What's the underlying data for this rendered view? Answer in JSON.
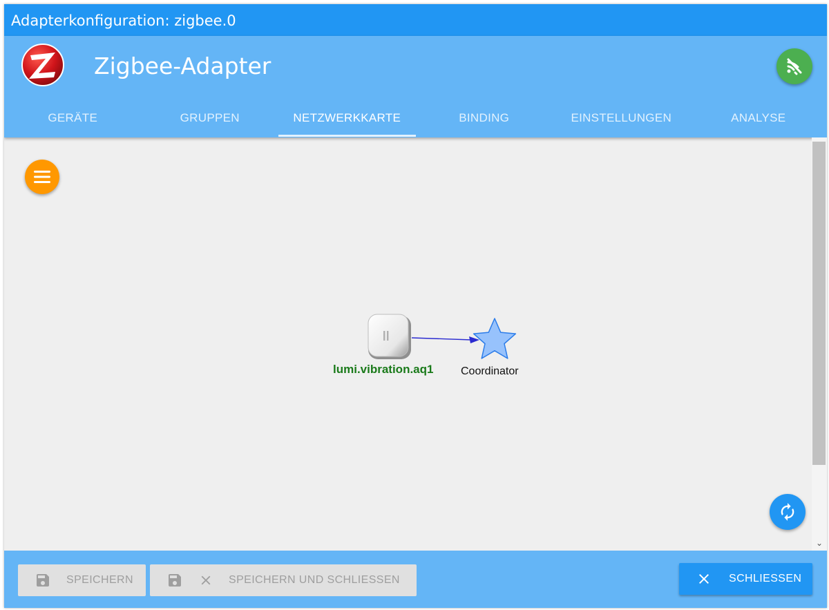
{
  "window": {
    "title": "Adapterkonfiguration: zigbee.0"
  },
  "appbar": {
    "title": "Zigbee-Adapter",
    "logo_icon": "zigbee-logo-icon",
    "status_icon": "wifi-signal-icon",
    "status_color": "#4caf50"
  },
  "tabs": [
    {
      "label": "GERÄTE",
      "active": false
    },
    {
      "label": "GRUPPEN",
      "active": false
    },
    {
      "label": "NETZWERKKARTE",
      "active": true
    },
    {
      "label": "BINDING",
      "active": false
    },
    {
      "label": "EINSTELLUNGEN",
      "active": false
    },
    {
      "label": "ANALYSE",
      "active": false
    }
  ],
  "map": {
    "menu_icon": "menu-icon",
    "refresh_icon": "refresh-icon",
    "device": {
      "label": "lumi.vibration.aq1",
      "icon": "vibration-sensor-icon"
    },
    "coordinator": {
      "label": "Coordinator",
      "icon": "star-icon"
    }
  },
  "footer": {
    "save_label": "SPEICHERN",
    "save_close_label": "SPEICHERN UND SCHLIESSEN",
    "close_label": "SCHLIESSEN"
  },
  "colors": {
    "primary": "#2196f3",
    "appbar": "#64b5f6",
    "accent_orange": "#ff9800",
    "device_label": "#1a7a1a"
  }
}
